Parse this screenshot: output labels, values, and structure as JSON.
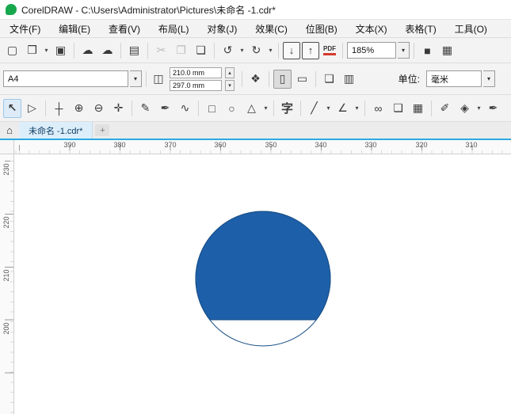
{
  "window": {
    "title": "CorelDRAW - C:\\Users\\Administrator\\Pictures\\未命名 -1.cdr*"
  },
  "ui": {
    "caret": "▾",
    "spin_up": "▴",
    "spin_down": "▾",
    "tab_add": "+",
    "home": "⌂"
  },
  "menu_bar": {
    "items": [
      "文件(F)",
      "编辑(E)",
      "查看(V)",
      "布局(L)",
      "对象(J)",
      "效果(C)",
      "位图(B)",
      "文本(X)",
      "表格(T)",
      "工具(O)"
    ]
  },
  "standard_toolbar": {
    "new_doc": "▢",
    "open": "❒",
    "save": "▣",
    "cloud_open": "☁",
    "cloud_save": "☁",
    "print": "▤",
    "cut": "✂",
    "copy": "❐",
    "paste": "❏",
    "undo": "↺",
    "redo": "↻",
    "import": "↓",
    "export": "↑",
    "pdf": "PDF",
    "zoom_level": "185%",
    "fullscreen": "■",
    "ruler": "▦"
  },
  "property_bar": {
    "page_size": "A4",
    "size_icon": "◫",
    "page_width": "210.0 mm",
    "page_height": "297.0 mm",
    "nudge_icon": "❖",
    "portrait_icon": "▯",
    "landscape_icon": "▭",
    "page_icon_a": "❏",
    "page_icon_b": "▥",
    "units_label": "单位:",
    "units_value": "毫米"
  },
  "toolbox": {
    "pick": "↖",
    "shape": "▷",
    "crop": "┼",
    "zoom": "⊕",
    "zoom_out": "⊖",
    "pan": "✛",
    "freehand": "✎",
    "bezier": "✒",
    "artistic": "∿",
    "rectangle": "□",
    "ellipse": "○",
    "polygon": "△",
    "text": "字",
    "line": "╱",
    "dimension": "∠",
    "glasses": "∞",
    "shadow": "❏",
    "mesh": "▦",
    "eyedropper": "✐",
    "fill": "◈",
    "outline": "✒"
  },
  "document_tabs": {
    "active_tab": "未命名 -1.cdr*"
  },
  "rulers": {
    "horizontal": [
      "390",
      "380",
      "370",
      "360",
      "350",
      "340",
      "330",
      "320",
      "310"
    ],
    "vertical": [
      "230",
      "220",
      "210",
      "200"
    ]
  },
  "canvas": {
    "page_color": "#ffffff",
    "shape_fill": "#1e5fa9",
    "shape_outline": "#174e85"
  }
}
